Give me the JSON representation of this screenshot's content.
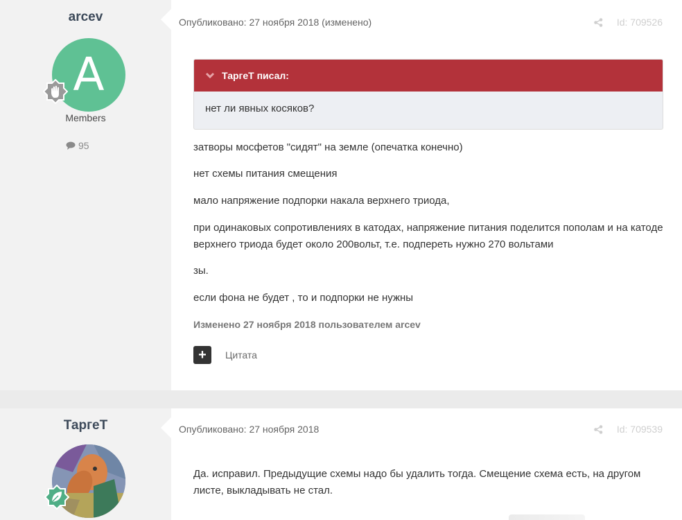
{
  "posts": [
    {
      "author": "arcev",
      "avatar_letter": "A",
      "avatar_color": "#5fc194",
      "role": "Members",
      "post_count": "95",
      "published": "Опубликовано: 27 ноября 2018 (изменено)",
      "post_id": "Id: 709526",
      "quote_header": "ТаргеТ писал:",
      "quote_text": "нет ли явных косяков?",
      "paragraphs": [
        "затворы мосфетов \"сидят\" на земле (опечатка конечно)",
        "нет схемы питания смещения",
        "мало напряжение подпорки накала верхнего триода,",
        "при одинаковых сопротивлениях в катодах, напряжение питания поделится пополам и на катоде верхнего триода будет около 200вольт, т.е. подпереть нужно 270 вольтами",
        "зы.",
        "если фона не будет , то и подпорки не нужны"
      ],
      "edited_note": "Изменено 27 ноября 2018 пользователем arcev",
      "quote_button": "Цитата"
    },
    {
      "author": "ТаргеТ",
      "published": "Опубликовано: 27 ноября 2018",
      "post_id": "Id: 709539",
      "paragraphs": [
        "Да. исправил. Предыдущие схемы надо бы удалить тогда. Смещение схема есть, на другом листе, выкладывать не стал."
      ]
    }
  ],
  "colors": {
    "quote_header": "#b3323a",
    "author_bg": "#f2f2f2",
    "content_bg": "#ffffff"
  }
}
